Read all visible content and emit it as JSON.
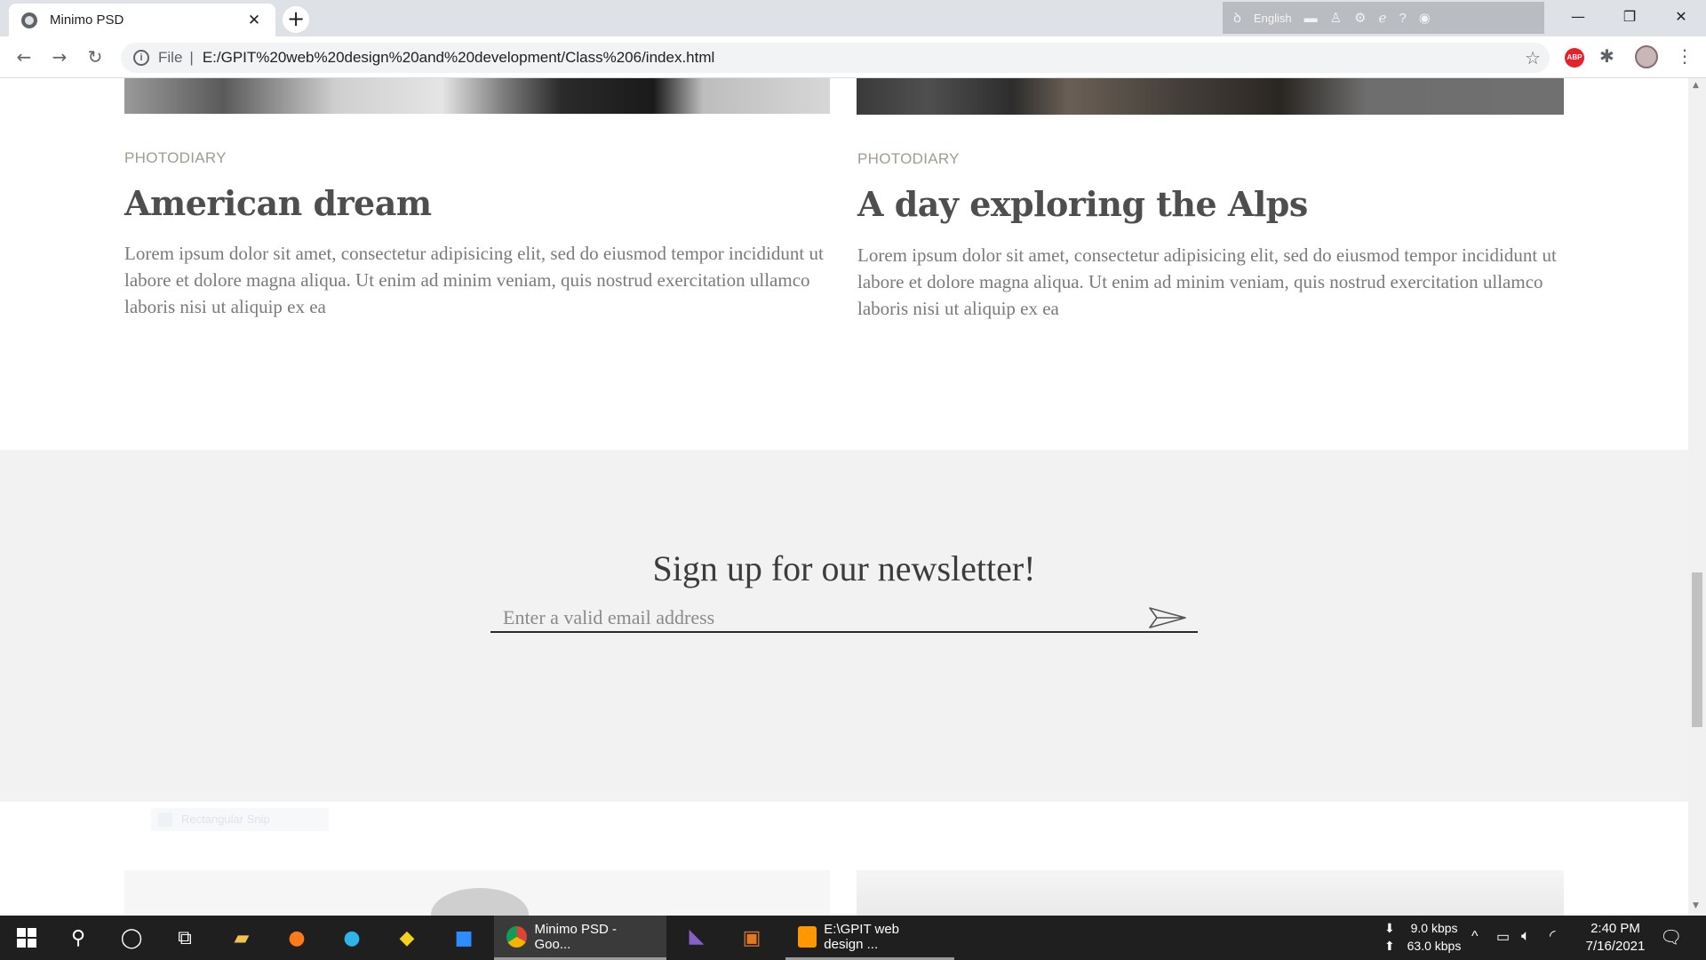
{
  "browser": {
    "tab_title": "Minimo PSD",
    "tab_close": "✕",
    "new_tab": "+",
    "url_scheme_label": "File",
    "url": "E:/GPIT%20web%20design%20and%20development/Class%206/index.html",
    "extension_language": "English",
    "window_controls": {
      "minimize": "—",
      "restore": "❐",
      "close": "✕"
    },
    "abp_label": "ABP"
  },
  "posts_top": [
    {
      "category": "PHOTODIARY",
      "title": "American dream",
      "excerpt": "Lorem ipsum dolor sit amet, consectetur adipisicing elit, sed do eiusmod tempor incididunt ut labore et dolore magna aliqua. Ut enim ad minim veniam, quis nostrud exercitation ullamco laboris nisi ut aliquip ex ea"
    },
    {
      "category": "PHOTODIARY",
      "title": "A day exploring the Alps",
      "excerpt": "Lorem ipsum dolor sit amet, consectetur adipisicing elit, sed do eiusmod tempor incididunt ut labore et dolore magna aliqua. Ut enim ad minim veniam, quis nostrud exercitation ullamco laboris nisi ut aliquip ex ea"
    }
  ],
  "newsletter": {
    "heading": "Sign up for our newsletter!",
    "email_placeholder": "Enter a valid email address"
  },
  "ghost_overlay": "Rectangular Snip",
  "taskbar": {
    "apps": [
      {
        "label": "Minimo PSD - Goo...",
        "active": true
      },
      {
        "label": "E:\\GPIT web design ...",
        "active": false
      }
    ],
    "net_down": "9.0 kbps",
    "net_up": "63.0 kbps",
    "time": "2:40 PM",
    "date": "7/16/2021"
  }
}
